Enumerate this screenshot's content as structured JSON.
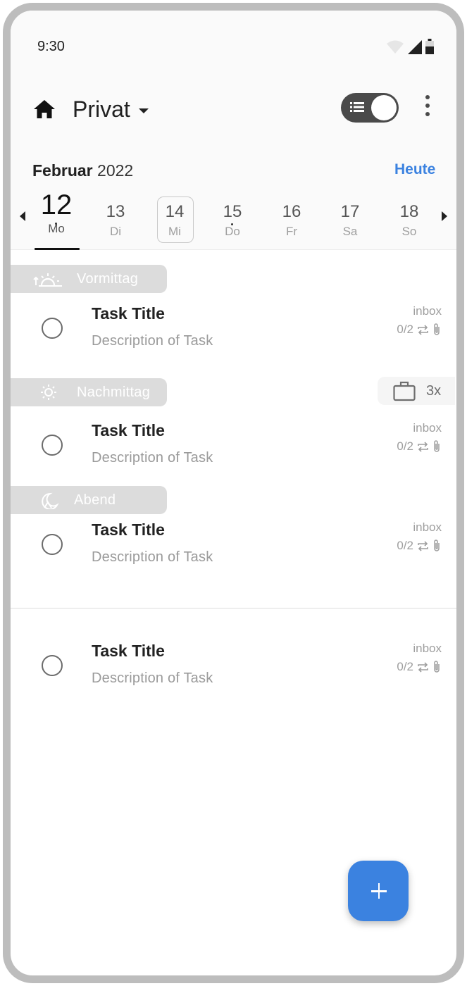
{
  "status_bar": {
    "time": "9:30"
  },
  "app_bar": {
    "title": "Privat"
  },
  "calendar": {
    "month": "Februar",
    "year": "2022",
    "today_label": "Heute",
    "days": [
      {
        "num": "12",
        "name": "Mo"
      },
      {
        "num": "13",
        "name": "Di"
      },
      {
        "num": "14",
        "name": "Mi"
      },
      {
        "num": "15",
        "name": "Do"
      },
      {
        "num": "16",
        "name": "Fr"
      },
      {
        "num": "17",
        "name": "Sa"
      },
      {
        "num": "18",
        "name": "So"
      }
    ]
  },
  "sections": [
    {
      "label": "Vormittag",
      "icon": "sunrise-icon"
    },
    {
      "label": "Nachmittag",
      "icon": "sun-icon"
    },
    {
      "label": "Abend",
      "icon": "moon-icon"
    }
  ],
  "work_badge": {
    "icon": "briefcase-icon",
    "count": "3x"
  },
  "tasks": [
    {
      "title": "Task Title",
      "description": "Description of Task",
      "list": "inbox",
      "progress": "0/2"
    },
    {
      "title": "Task Title",
      "description": "Description of Task",
      "list": "inbox",
      "progress": "0/2"
    },
    {
      "title": "Task Title",
      "description": "Description of Task",
      "list": "inbox",
      "progress": "0/2"
    },
    {
      "title": "Task Title",
      "description": "Description of Task",
      "list": "inbox",
      "progress": "0/2"
    }
  ],
  "colors": {
    "accent": "#3b82e0",
    "pill": "#dcdcdc",
    "toggle": "#4a4a4a"
  }
}
